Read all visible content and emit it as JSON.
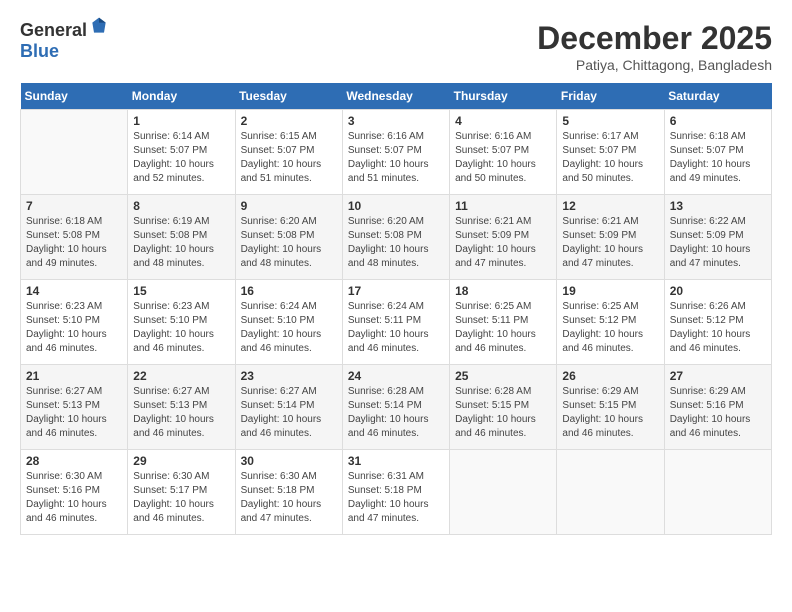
{
  "logo": {
    "general": "General",
    "blue": "Blue"
  },
  "title": {
    "month": "December 2025",
    "location": "Patiya, Chittagong, Bangladesh"
  },
  "days_header": [
    "Sunday",
    "Monday",
    "Tuesday",
    "Wednesday",
    "Thursday",
    "Friday",
    "Saturday"
  ],
  "weeks": [
    [
      {
        "day": "",
        "sunrise": "",
        "sunset": "",
        "daylight": ""
      },
      {
        "day": "1",
        "sunrise": "Sunrise: 6:14 AM",
        "sunset": "Sunset: 5:07 PM",
        "daylight": "Daylight: 10 hours and 52 minutes."
      },
      {
        "day": "2",
        "sunrise": "Sunrise: 6:15 AM",
        "sunset": "Sunset: 5:07 PM",
        "daylight": "Daylight: 10 hours and 51 minutes."
      },
      {
        "day": "3",
        "sunrise": "Sunrise: 6:16 AM",
        "sunset": "Sunset: 5:07 PM",
        "daylight": "Daylight: 10 hours and 51 minutes."
      },
      {
        "day": "4",
        "sunrise": "Sunrise: 6:16 AM",
        "sunset": "Sunset: 5:07 PM",
        "daylight": "Daylight: 10 hours and 50 minutes."
      },
      {
        "day": "5",
        "sunrise": "Sunrise: 6:17 AM",
        "sunset": "Sunset: 5:07 PM",
        "daylight": "Daylight: 10 hours and 50 minutes."
      },
      {
        "day": "6",
        "sunrise": "Sunrise: 6:18 AM",
        "sunset": "Sunset: 5:07 PM",
        "daylight": "Daylight: 10 hours and 49 minutes."
      }
    ],
    [
      {
        "day": "7",
        "sunrise": "Sunrise: 6:18 AM",
        "sunset": "Sunset: 5:08 PM",
        "daylight": "Daylight: 10 hours and 49 minutes."
      },
      {
        "day": "8",
        "sunrise": "Sunrise: 6:19 AM",
        "sunset": "Sunset: 5:08 PM",
        "daylight": "Daylight: 10 hours and 48 minutes."
      },
      {
        "day": "9",
        "sunrise": "Sunrise: 6:20 AM",
        "sunset": "Sunset: 5:08 PM",
        "daylight": "Daylight: 10 hours and 48 minutes."
      },
      {
        "day": "10",
        "sunrise": "Sunrise: 6:20 AM",
        "sunset": "Sunset: 5:08 PM",
        "daylight": "Daylight: 10 hours and 48 minutes."
      },
      {
        "day": "11",
        "sunrise": "Sunrise: 6:21 AM",
        "sunset": "Sunset: 5:09 PM",
        "daylight": "Daylight: 10 hours and 47 minutes."
      },
      {
        "day": "12",
        "sunrise": "Sunrise: 6:21 AM",
        "sunset": "Sunset: 5:09 PM",
        "daylight": "Daylight: 10 hours and 47 minutes."
      },
      {
        "day": "13",
        "sunrise": "Sunrise: 6:22 AM",
        "sunset": "Sunset: 5:09 PM",
        "daylight": "Daylight: 10 hours and 47 minutes."
      }
    ],
    [
      {
        "day": "14",
        "sunrise": "Sunrise: 6:23 AM",
        "sunset": "Sunset: 5:10 PM",
        "daylight": "Daylight: 10 hours and 46 minutes."
      },
      {
        "day": "15",
        "sunrise": "Sunrise: 6:23 AM",
        "sunset": "Sunset: 5:10 PM",
        "daylight": "Daylight: 10 hours and 46 minutes."
      },
      {
        "day": "16",
        "sunrise": "Sunrise: 6:24 AM",
        "sunset": "Sunset: 5:10 PM",
        "daylight": "Daylight: 10 hours and 46 minutes."
      },
      {
        "day": "17",
        "sunrise": "Sunrise: 6:24 AM",
        "sunset": "Sunset: 5:11 PM",
        "daylight": "Daylight: 10 hours and 46 minutes."
      },
      {
        "day": "18",
        "sunrise": "Sunrise: 6:25 AM",
        "sunset": "Sunset: 5:11 PM",
        "daylight": "Daylight: 10 hours and 46 minutes."
      },
      {
        "day": "19",
        "sunrise": "Sunrise: 6:25 AM",
        "sunset": "Sunset: 5:12 PM",
        "daylight": "Daylight: 10 hours and 46 minutes."
      },
      {
        "day": "20",
        "sunrise": "Sunrise: 6:26 AM",
        "sunset": "Sunset: 5:12 PM",
        "daylight": "Daylight: 10 hours and 46 minutes."
      }
    ],
    [
      {
        "day": "21",
        "sunrise": "Sunrise: 6:27 AM",
        "sunset": "Sunset: 5:13 PM",
        "daylight": "Daylight: 10 hours and 46 minutes."
      },
      {
        "day": "22",
        "sunrise": "Sunrise: 6:27 AM",
        "sunset": "Sunset: 5:13 PM",
        "daylight": "Daylight: 10 hours and 46 minutes."
      },
      {
        "day": "23",
        "sunrise": "Sunrise: 6:27 AM",
        "sunset": "Sunset: 5:14 PM",
        "daylight": "Daylight: 10 hours and 46 minutes."
      },
      {
        "day": "24",
        "sunrise": "Sunrise: 6:28 AM",
        "sunset": "Sunset: 5:14 PM",
        "daylight": "Daylight: 10 hours and 46 minutes."
      },
      {
        "day": "25",
        "sunrise": "Sunrise: 6:28 AM",
        "sunset": "Sunset: 5:15 PM",
        "daylight": "Daylight: 10 hours and 46 minutes."
      },
      {
        "day": "26",
        "sunrise": "Sunrise: 6:29 AM",
        "sunset": "Sunset: 5:15 PM",
        "daylight": "Daylight: 10 hours and 46 minutes."
      },
      {
        "day": "27",
        "sunrise": "Sunrise: 6:29 AM",
        "sunset": "Sunset: 5:16 PM",
        "daylight": "Daylight: 10 hours and 46 minutes."
      }
    ],
    [
      {
        "day": "28",
        "sunrise": "Sunrise: 6:30 AM",
        "sunset": "Sunset: 5:16 PM",
        "daylight": "Daylight: 10 hours and 46 minutes."
      },
      {
        "day": "29",
        "sunrise": "Sunrise: 6:30 AM",
        "sunset": "Sunset: 5:17 PM",
        "daylight": "Daylight: 10 hours and 46 minutes."
      },
      {
        "day": "30",
        "sunrise": "Sunrise: 6:30 AM",
        "sunset": "Sunset: 5:18 PM",
        "daylight": "Daylight: 10 hours and 47 minutes."
      },
      {
        "day": "31",
        "sunrise": "Sunrise: 6:31 AM",
        "sunset": "Sunset: 5:18 PM",
        "daylight": "Daylight: 10 hours and 47 minutes."
      },
      {
        "day": "",
        "sunrise": "",
        "sunset": "",
        "daylight": ""
      },
      {
        "day": "",
        "sunrise": "",
        "sunset": "",
        "daylight": ""
      },
      {
        "day": "",
        "sunrise": "",
        "sunset": "",
        "daylight": ""
      }
    ]
  ]
}
